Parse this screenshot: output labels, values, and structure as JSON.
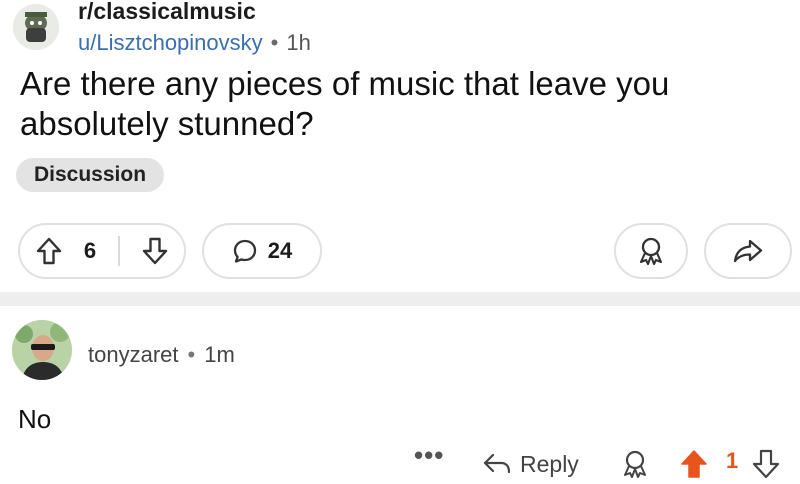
{
  "post": {
    "subreddit": "r/classicalmusic",
    "author": "u/Lisztchopinovsky",
    "separator": "•",
    "time": "1h",
    "title": "Are there any pieces of music that leave you absolutely stunned?",
    "flair": "Discussion",
    "upvotes": "6",
    "comments": "24"
  },
  "comment": {
    "author": "tonyzaret",
    "separator": "•",
    "time": "1m",
    "text": "No",
    "more": "•••",
    "reply_label": "Reply",
    "score": "1"
  },
  "colors": {
    "upvote_active": "#e8541e",
    "author_link": "#3a6fb0",
    "flair_bg": "#e3e3e3"
  }
}
